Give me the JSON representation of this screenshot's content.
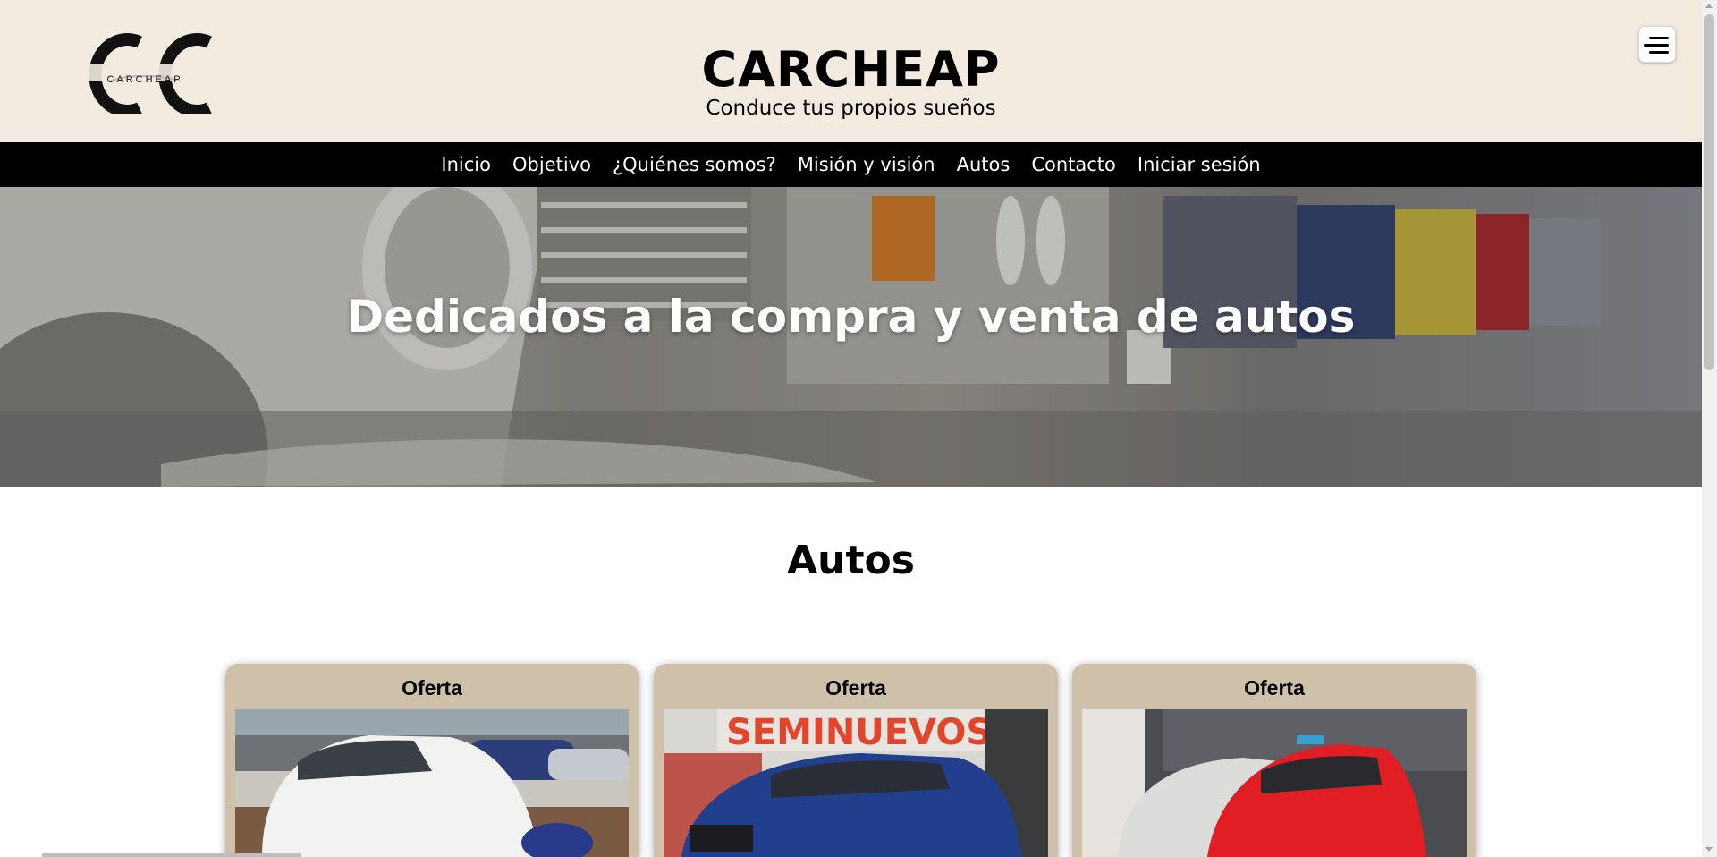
{
  "header": {
    "logo_text": "CARCHEAP",
    "title": "CARCHEAP",
    "subtitle": "Conduce tus propios sueños",
    "menu_icon": "hamburger-menu-icon"
  },
  "nav": {
    "items": [
      {
        "label": "Inicio"
      },
      {
        "label": "Objetivo"
      },
      {
        "label": "¿Quiénes somos?"
      },
      {
        "label": "Misión y visión"
      },
      {
        "label": "Autos"
      },
      {
        "label": "Contacto"
      },
      {
        "label": "Iniciar sesión"
      }
    ]
  },
  "hero": {
    "title": "Dedicados a la compra y venta de autos"
  },
  "autos": {
    "title": "Autos",
    "cards": [
      {
        "label": "Oferta",
        "car_color": "#f2f2f0"
      },
      {
        "label": "Oferta",
        "car_color": "#213f8c",
        "banner_text": "SEMINUEVOS"
      },
      {
        "label": "Oferta",
        "car_color": "#e01e24"
      }
    ]
  },
  "colors": {
    "header_bg": "#f3ebe0",
    "nav_bg": "#000000",
    "card_bg": "#cfc1a9"
  }
}
